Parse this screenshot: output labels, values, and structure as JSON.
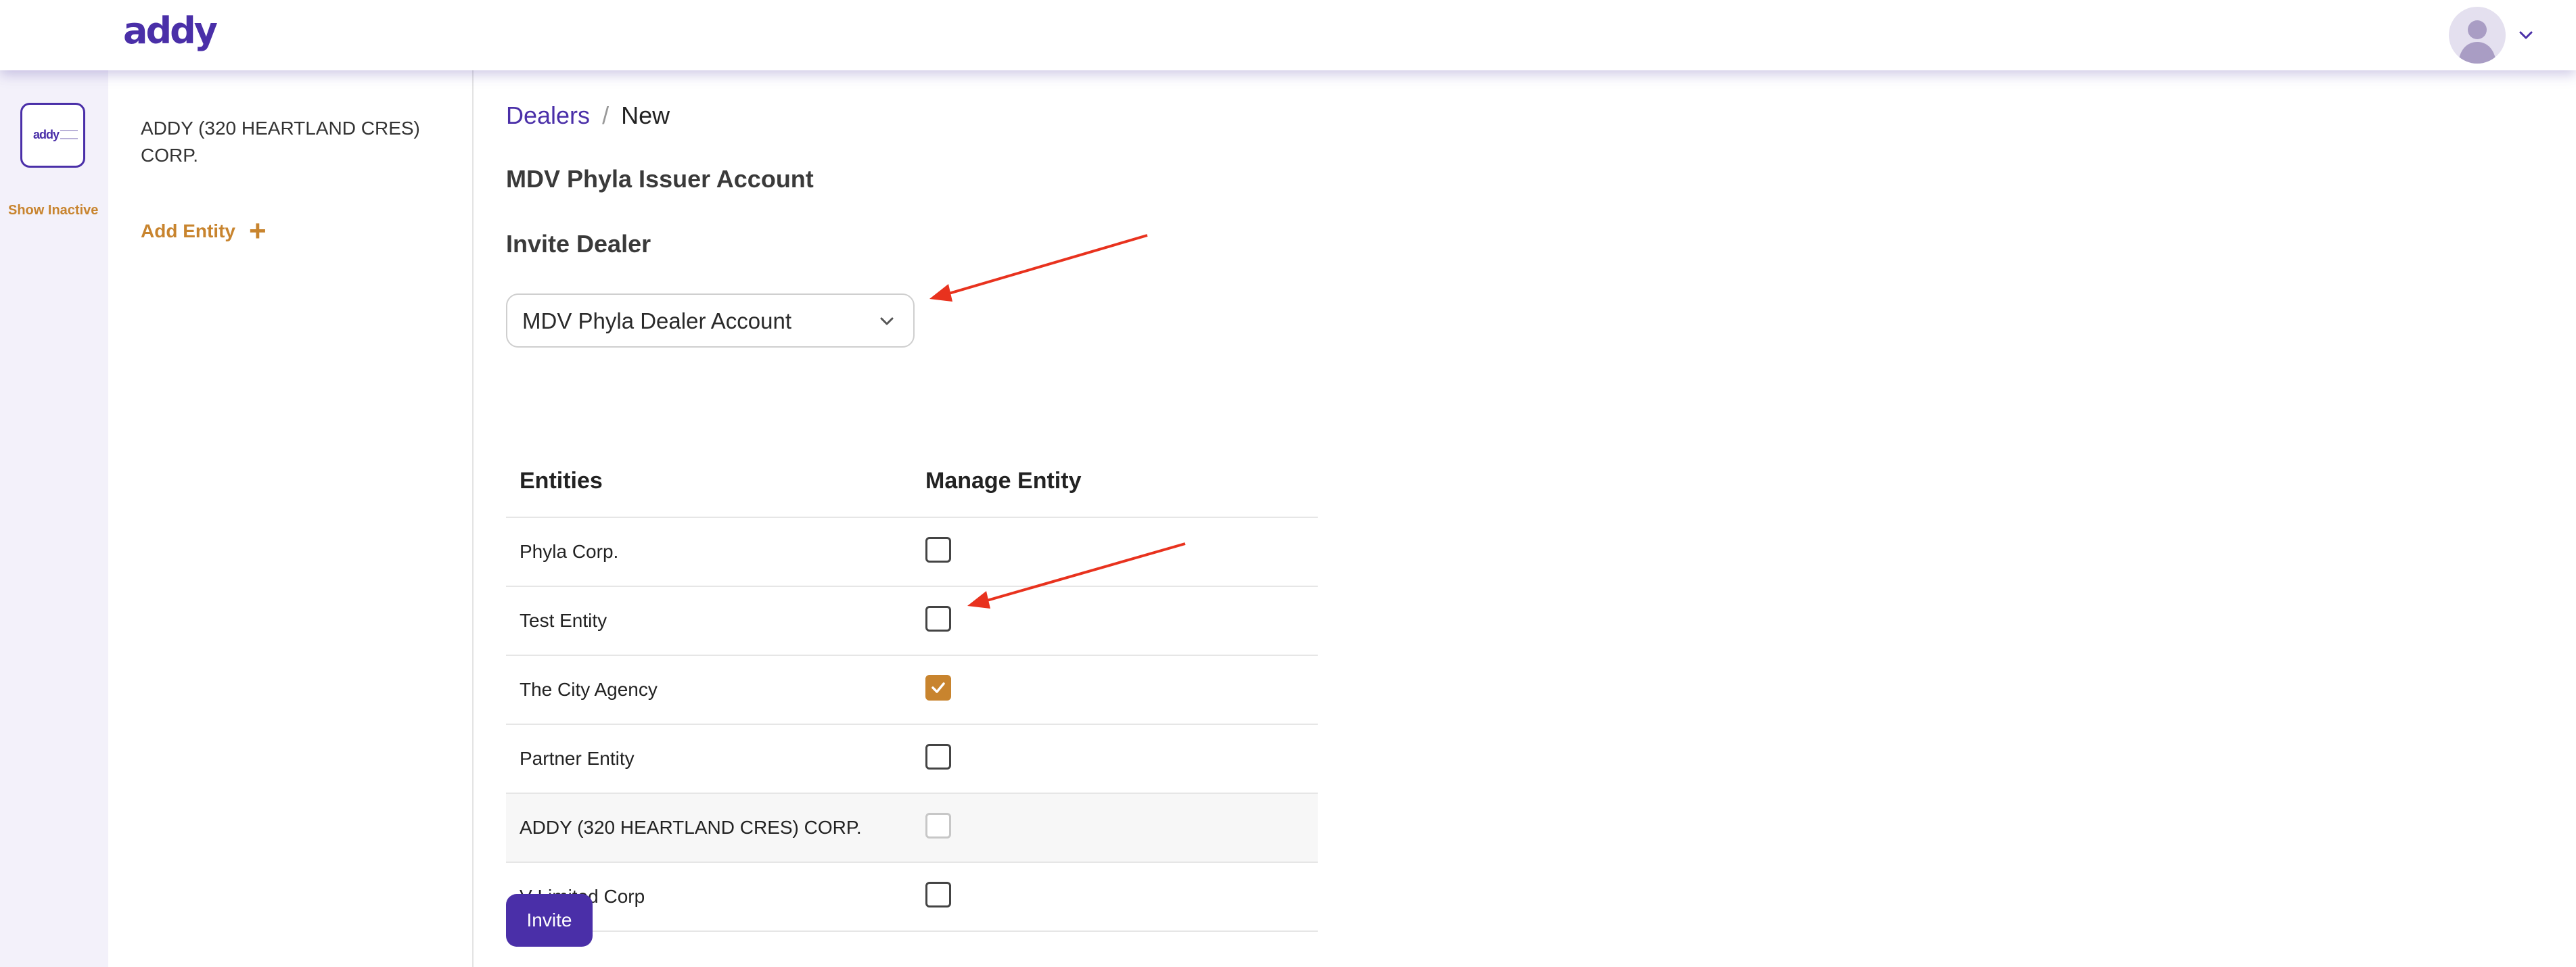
{
  "header": {
    "logo_text": "addy",
    "avatar": "user-avatar",
    "menu_icon": "chevron-down-icon"
  },
  "rail": {
    "tile_text": "addy",
    "show_inactive": "Show Inactive"
  },
  "sidebar": {
    "entity_name": "ADDY (320 HEARTLAND CRES) CORP.",
    "add_entity": "Add Entity",
    "add_icon": "plus-icon"
  },
  "main": {
    "breadcrumb": {
      "parent": "Dealers",
      "separator": "/",
      "current": "New"
    },
    "issuer_title": "MDV Phyla Issuer Account",
    "invite_title": "Invite Dealer",
    "dealer_select": {
      "value": "MDV Phyla Dealer Account"
    },
    "table": {
      "headers": [
        "Entities",
        "Manage Entity"
      ],
      "rows": [
        {
          "name": "Phyla Corp.",
          "checked": false,
          "disabled": false
        },
        {
          "name": "Test Entity",
          "checked": false,
          "disabled": false
        },
        {
          "name": "The City Agency",
          "checked": true,
          "disabled": false
        },
        {
          "name": "Partner Entity",
          "checked": false,
          "disabled": false
        },
        {
          "name": "ADDY (320 HEARTLAND CRES) CORP.",
          "checked": false,
          "disabled": true
        },
        {
          "name": "V Limited Corp",
          "checked": false,
          "disabled": false
        }
      ]
    },
    "invite_button": "Invite"
  },
  "colors": {
    "brand": "#4a2fa8",
    "accent": "#c8842e",
    "annotation": "#e8321e"
  }
}
